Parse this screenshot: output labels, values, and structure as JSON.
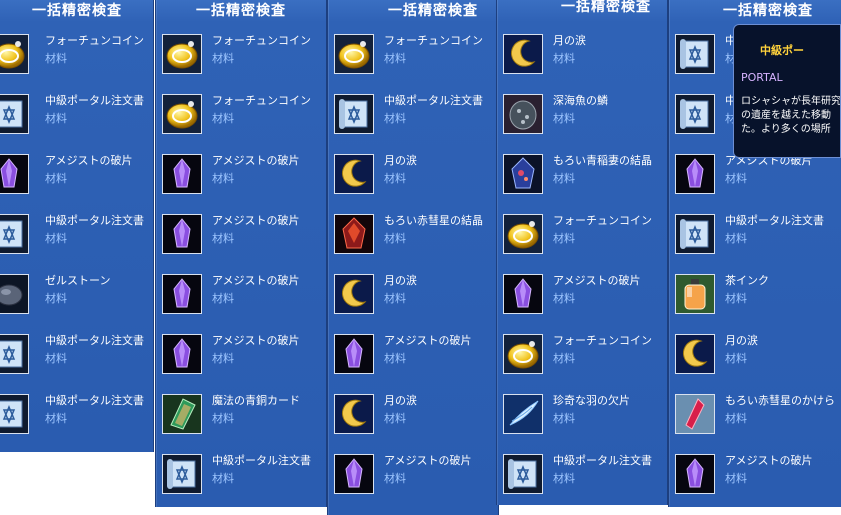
{
  "panels": [
    {
      "title": "一括精密検査",
      "items": [
        {
          "name": "フォーチュンコイン",
          "sub": "材料",
          "icon": "coin-icon"
        },
        {
          "name": "中級ポータル注文書",
          "sub": "材料",
          "icon": "scroll-icon"
        },
        {
          "name": "アメジストの破片",
          "sub": "材料",
          "icon": "amethyst-icon"
        },
        {
          "name": "中級ポータル注文書",
          "sub": "材料",
          "icon": "scroll-icon"
        },
        {
          "name": "ゼルストーン",
          "sub": "材料",
          "icon": "stone-icon"
        },
        {
          "name": "中級ポータル注文書",
          "sub": "材料",
          "icon": "scroll-icon"
        },
        {
          "name": "中級ポータル注文書",
          "sub": "材料",
          "icon": "scroll-icon"
        }
      ]
    },
    {
      "title": "一括精密検査",
      "items": [
        {
          "name": "フォーチュンコイン",
          "sub": "材料",
          "icon": "coin-icon"
        },
        {
          "name": "フォーチュンコイン",
          "sub": "材料",
          "icon": "coin-icon"
        },
        {
          "name": "アメジストの破片",
          "sub": "材料",
          "icon": "amethyst-icon"
        },
        {
          "name": "アメジストの破片",
          "sub": "材料",
          "icon": "amethyst-icon"
        },
        {
          "name": "アメジストの破片",
          "sub": "材料",
          "icon": "amethyst-icon"
        },
        {
          "name": "アメジストの破片",
          "sub": "材料",
          "icon": "amethyst-icon"
        },
        {
          "name": "魔法の青銅カード",
          "sub": "材料",
          "icon": "card-icon"
        },
        {
          "name": "中級ポータル注文書",
          "sub": "材料",
          "icon": "scroll-icon"
        }
      ]
    },
    {
      "title": "一括精密検査",
      "items": [
        {
          "name": "フォーチュンコイン",
          "sub": "材料",
          "icon": "coin-icon"
        },
        {
          "name": "中級ポータル注文書",
          "sub": "材料",
          "icon": "scroll-icon"
        },
        {
          "name": "月の涙",
          "sub": "材料",
          "icon": "moon-icon"
        },
        {
          "name": "もろい赤彗星の結晶",
          "sub": "材料",
          "icon": "red-crystal-icon"
        },
        {
          "name": "月の涙",
          "sub": "材料",
          "icon": "moon-icon"
        },
        {
          "name": "アメジストの破片",
          "sub": "材料",
          "icon": "amethyst-icon"
        },
        {
          "name": "月の涙",
          "sub": "材料",
          "icon": "moon-icon"
        },
        {
          "name": "アメジストの破片",
          "sub": "材料",
          "icon": "amethyst-icon"
        }
      ]
    },
    {
      "title": "一括精密検査",
      "items": [
        {
          "name": "月の涙",
          "sub": "材料",
          "icon": "moon-icon"
        },
        {
          "name": "深海魚の鱗",
          "sub": "材料",
          "icon": "scale-icon"
        },
        {
          "name": "もろい青稲妻の結晶",
          "sub": "材料",
          "icon": "blue-crystal-icon"
        },
        {
          "name": "フォーチュンコイン",
          "sub": "材料",
          "icon": "coin-icon"
        },
        {
          "name": "アメジストの破片",
          "sub": "材料",
          "icon": "amethyst-icon"
        },
        {
          "name": "フォーチュンコイン",
          "sub": "材料",
          "icon": "coin-icon"
        },
        {
          "name": "珍奇な羽の欠片",
          "sub": "材料",
          "icon": "feather-icon"
        },
        {
          "name": "中級ポータル注文書",
          "sub": "材料",
          "icon": "scroll-icon"
        }
      ]
    },
    {
      "title": "一括精密検査",
      "items": [
        {
          "name": "中級ポータル注文書",
          "sub": "材料",
          "icon": "scroll-icon"
        },
        {
          "name": "中級ポータル注文書",
          "sub": "材料",
          "icon": "scroll-icon"
        },
        {
          "name": "アメジストの破片",
          "sub": "材料",
          "icon": "amethyst-icon"
        },
        {
          "name": "中級ポータル注文書",
          "sub": "材料",
          "icon": "scroll-icon"
        },
        {
          "name": "茶インク",
          "sub": "材料",
          "icon": "ink-icon"
        },
        {
          "name": "月の涙",
          "sub": "材料",
          "icon": "moon-icon"
        },
        {
          "name": "もろい赤彗星のかけら",
          "sub": "材料",
          "icon": "red-shard-icon"
        },
        {
          "name": "アメジストの破片",
          "sub": "材料",
          "icon": "amethyst-icon"
        }
      ]
    }
  ],
  "tooltip": {
    "name": "中級ポー",
    "type": "PORTAL",
    "desc": "ロシャシャが長年研究\nの遺産を越えた移動\nた。より多くの場所"
  }
}
